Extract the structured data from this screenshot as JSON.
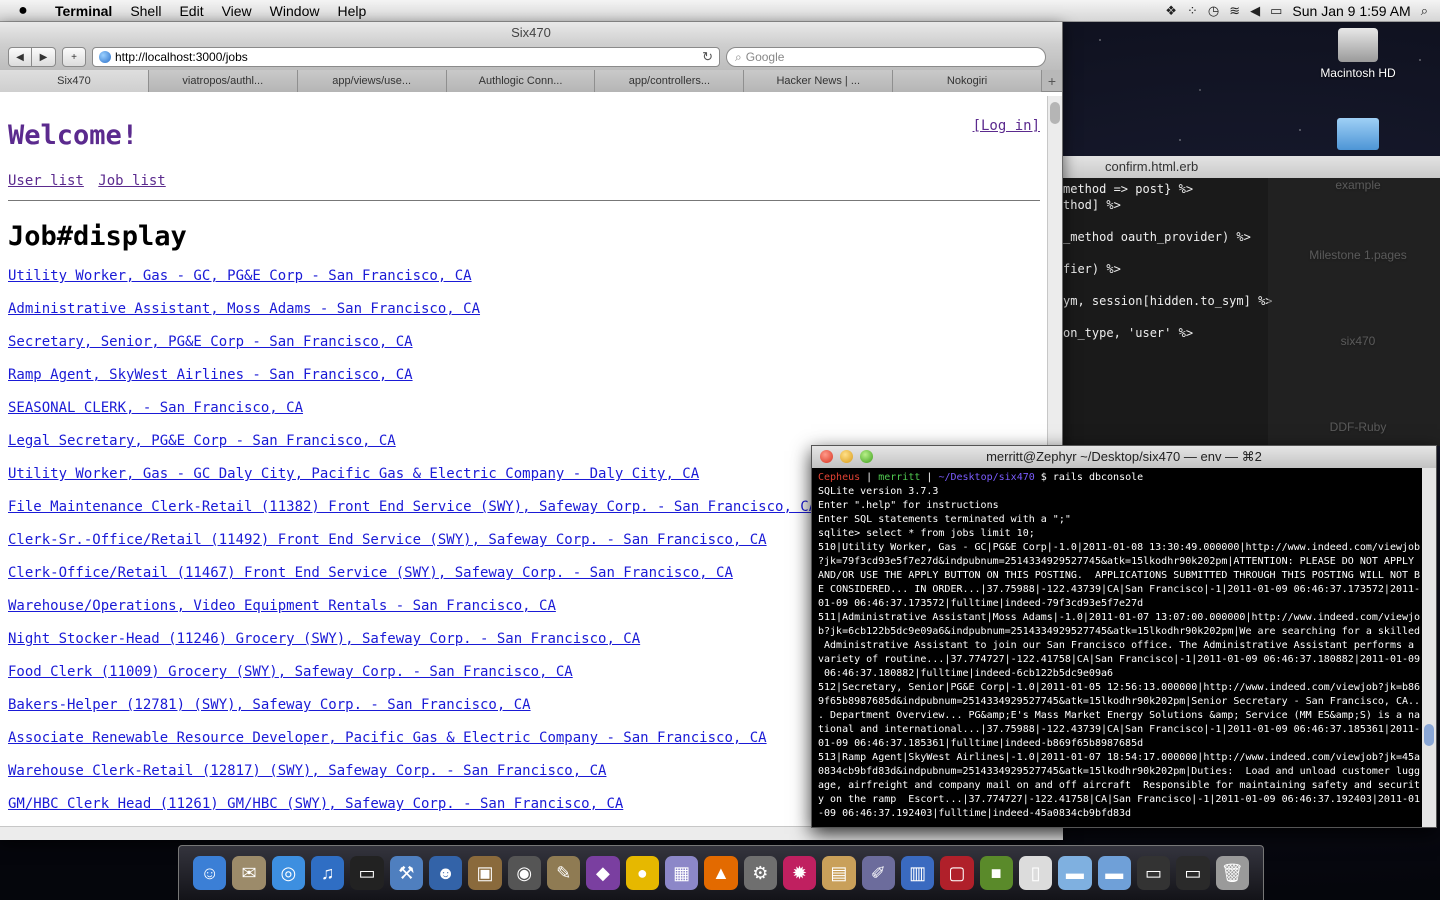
{
  "menubar": {
    "apple": "",
    "app_name": "Terminal",
    "items": [
      "Shell",
      "Edit",
      "View",
      "Window",
      "Help"
    ],
    "clock": "Sun Jan 9  1:59 AM"
  },
  "browser": {
    "window_title": "Six470",
    "url": "http://localhost:3000/jobs",
    "search_placeholder": "Google",
    "tabs": [
      "Six470",
      "viatropos/authl...",
      "app/views/use...",
      "Authlogic Conn...",
      "app/controllers...",
      "Hacker News | ...",
      "Nokogiri"
    ],
    "page": {
      "welcome": "Welcome!",
      "login": "[Log in]",
      "nav": [
        "User list",
        "Job list"
      ],
      "heading": "Job#display",
      "jobs": [
        "Utility Worker, Gas - GC, PG&E Corp - San Francisco, CA",
        "Administrative Assistant, Moss Adams - San Francisco, CA",
        "Secretary, Senior, PG&E Corp - San Francisco, CA",
        "Ramp Agent, SkyWest Airlines - San Francisco, CA",
        "SEASONAL CLERK, - San Francisco, CA",
        "Legal Secretary, PG&E Corp - San Francisco, CA",
        "Utility Worker, Gas - GC Daly City, Pacific Gas & Electric Company - Daly City, CA",
        "File Maintenance Clerk-Retail (11382) Front End Service (SWY), Safeway Corp. - San Francisco, CA",
        "Clerk-Sr.-Office/Retail (11492) Front End Service (SWY), Safeway Corp. - San Francisco, CA",
        "Clerk-Office/Retail (11467) Front End Service (SWY), Safeway Corp. - San Francisco, CA",
        "Warehouse/Operations, Video Equipment Rentals - San Francisco, CA",
        "Night Stocker-Head (11246) Grocery (SWY), Safeway Corp. - San Francisco, CA",
        "Food Clerk (11009) Grocery (SWY), Safeway Corp. - San Francisco, CA",
        "Bakers-Helper (12781) (SWY), Safeway Corp. - San Francisco, CA",
        "Associate Renewable Resource Developer, Pacific Gas & Electric Company - San Francisco, CA",
        "Warehouse Clerk-Retail (12817) (SWY), Safeway Corp. - San Francisco, CA",
        "GM/HBC Clerk Head (11261) GM/HBC (SWY), Safeway Corp. - San Francisco, CA"
      ]
    }
  },
  "editor": {
    "title": "confirm.html.erb",
    "lines": [
      {
        "a": "method => post} %>",
        "b": ""
      },
      {
        "a": "thod] %>",
        "b": ""
      },
      {
        "a": "",
        "b": ""
      },
      {
        "a": "_method oauth_provider) %>",
        "b": ""
      },
      {
        "a": "",
        "b": ""
      },
      {
        "a": "fier) %>",
        "b": ""
      },
      {
        "a": "",
        "b": ""
      },
      {
        "a": "ym, session[hidden.to_sym] %>",
        "b": ""
      },
      {
        "a": "",
        "b": ""
      },
      {
        "a": "on_type, 'user' %>",
        "b": ""
      }
    ]
  },
  "desktop_icons": {
    "hd": "Macintosh HD",
    "faded": [
      "example",
      "Milestone 1.pages",
      "six470",
      "DDF-Ruby"
    ]
  },
  "terminal": {
    "title": "merritt@Zephyr ~/Desktop/six470 — env — ⌘2",
    "prompt_host": "Cepheus",
    "prompt_user": "merritt",
    "prompt_path": "~/Desktop/six470",
    "command": "$ rails dbconsole",
    "lines": [
      "SQLite version 3.7.3",
      "Enter \".help\" for instructions",
      "Enter SQL statements terminated with a \";\"",
      "sqlite> select * from jobs limit 10;",
      "510|Utility Worker, Gas - GC|PG&E Corp|-1.0|2011-01-08 13:30:49.000000|http://www.indeed.com/viewjob",
      "?jk=79f3cd93e5f7e27d&indpubnum=2514334929527745&atk=15lkodhr90k202pm|ATTENTION: PLEASE DO NOT APPLY",
      "AND/OR USE THE APPLY BUTTON ON THIS POSTING.  APPLICATIONS SUBMITTED THROUGH THIS POSTING WILL NOT B",
      "E CONSIDERED... IN ORDER...|37.75988|-122.43739|CA|San Francisco|-1|2011-01-09 06:46:37.173572|2011-",
      "01-09 06:46:37.173572|fulltime|indeed-79f3cd93e5f7e27d",
      "511|Administrative Assistant|Moss Adams|-1.0|2011-01-07 13:07:00.000000|http://www.indeed.com/viewjo",
      "b?jk=6cb122b5dc9e09a6&indpubnum=2514334929527745&atk=15lkodhr90k202pm|We are searching for a skilled",
      " Administrative Assistant to join our San Francisco office. The Administrative Assistant performs a",
      "variety of routine...|37.774727|-122.41758|CA|San Francisco|-1|2011-01-09 06:46:37.180882|2011-01-09",
      " 06:46:37.180882|fulltime|indeed-6cb122b5dc9e09a6",
      "512|Secretary, Senior|PG&E Corp|-1.0|2011-01-05 12:56:13.000000|http://www.indeed.com/viewjob?jk=b86",
      "9f65b8987685d&indpubnum=2514334929527745&atk=15lkodhr90k202pm|Senior Secretary - San Francisco, CA..",
      ". Department Overview... PG&amp;E's Mass Market Energy Solutions &amp; Service (MM ES&amp;S) is a na",
      "tional and international...|37.75988|-122.43739|CA|San Francisco|-1|2011-01-09 06:46:37.185361|2011-",
      "01-09 06:46:37.185361|fulltime|indeed-b869f65b8987685d",
      "513|Ramp Agent|SkyWest Airlines|-1.0|2011-01-07 18:54:17.000000|http://www.indeed.com/viewjob?jk=45a",
      "0834cb9bfd83d&indpubnum=2514334929527745&atk=15lkodhr90k202pm|Duties:  Load and unload customer lugg",
      "age, airfreight and company mail on and off aircraft  Responsible for maintaining safety and securit",
      "y on the ramp  Escort...|37.774727|-122.41758|CA|San Francisco|-1|2011-01-09 06:46:37.192403|2011-01",
      "-09 06:46:37.192403|fulltime|indeed-45a0834cb9bfd83d"
    ]
  },
  "dock": {
    "icons": [
      {
        "name": "finder-icon",
        "glyph": "☺",
        "color": "#3b7fd6"
      },
      {
        "name": "mail-icon",
        "glyph": "✉",
        "color": "#9c8b6a"
      },
      {
        "name": "safari-icon",
        "glyph": "◎",
        "color": "#3d8fe0"
      },
      {
        "name": "itunes-icon",
        "glyph": "♫",
        "color": "#2f6ec4"
      },
      {
        "name": "terminal-icon",
        "glyph": "▭",
        "color": "#222222"
      },
      {
        "name": "xcode-icon",
        "glyph": "⚒",
        "color": "#4f7fbf"
      },
      {
        "name": "ichat-icon",
        "glyph": "☻",
        "color": "#3363a8"
      },
      {
        "name": "photo-icon",
        "glyph": "▣",
        "color": "#8a6a3c"
      },
      {
        "name": "camera-icon",
        "glyph": "◉",
        "color": "#555555"
      },
      {
        "name": "gimp-icon",
        "glyph": "✎",
        "color": "#8f7b53"
      },
      {
        "name": "app-icon",
        "glyph": "◆",
        "color": "#7a3fa0"
      },
      {
        "name": "adium-icon",
        "glyph": "●",
        "color": "#e6b800"
      },
      {
        "name": "archive-icon",
        "glyph": "▦",
        "color": "#8c87c8"
      },
      {
        "name": "vlc-icon",
        "glyph": "▲",
        "color": "#e36a00"
      },
      {
        "name": "system-preferences-icon",
        "glyph": "⚙",
        "color": "#6f6f6f"
      },
      {
        "name": "burst-icon",
        "glyph": "✹",
        "color": "#c02060"
      },
      {
        "name": "presentation-icon",
        "glyph": "▤",
        "color": "#c9a05a"
      },
      {
        "name": "brush-icon",
        "glyph": "✐",
        "color": "#6c6c9c"
      },
      {
        "name": "chart-app-icon",
        "glyph": "▥",
        "color": "#3a6ac0"
      },
      {
        "name": "parallels-icon",
        "glyph": "▢",
        "color": "#b0202a"
      },
      {
        "name": "minecraft-icon",
        "glyph": "■",
        "color": "#5a8a2a"
      },
      {
        "name": "document-icon",
        "glyph": "▯",
        "color": "#dcdcdc"
      },
      {
        "name": "folder-icon",
        "glyph": "▬",
        "color": "#7fb0e0"
      },
      {
        "name": "folder-icon-2",
        "glyph": "▬",
        "color": "#6fa0d8"
      },
      {
        "name": "screen-icon",
        "glyph": "▭",
        "color": "#333333"
      },
      {
        "name": "screen-icon-2",
        "glyph": "▭",
        "color": "#2a2a2a"
      },
      {
        "name": "trash-icon",
        "glyph": "🗑",
        "color": "#9a9a9a"
      }
    ]
  }
}
